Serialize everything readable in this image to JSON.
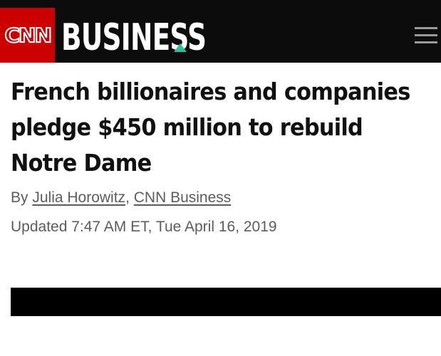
{
  "header": {
    "logo_text": "CNN",
    "section_title": "BUSINESS",
    "accent_color": "#2fbf9f",
    "brand_red": "#cc0000",
    "menu_icon": "hamburger-menu-icon"
  },
  "article": {
    "headline": "French billionaires and companies pledge $450 million to rebuild Notre Dame",
    "byline_prefix": "By ",
    "author": "Julia Horowitz",
    "separator": ", ",
    "publisher": "CNN Business",
    "updated": "Updated 7:47 AM ET, Tue April 16, 2019"
  }
}
